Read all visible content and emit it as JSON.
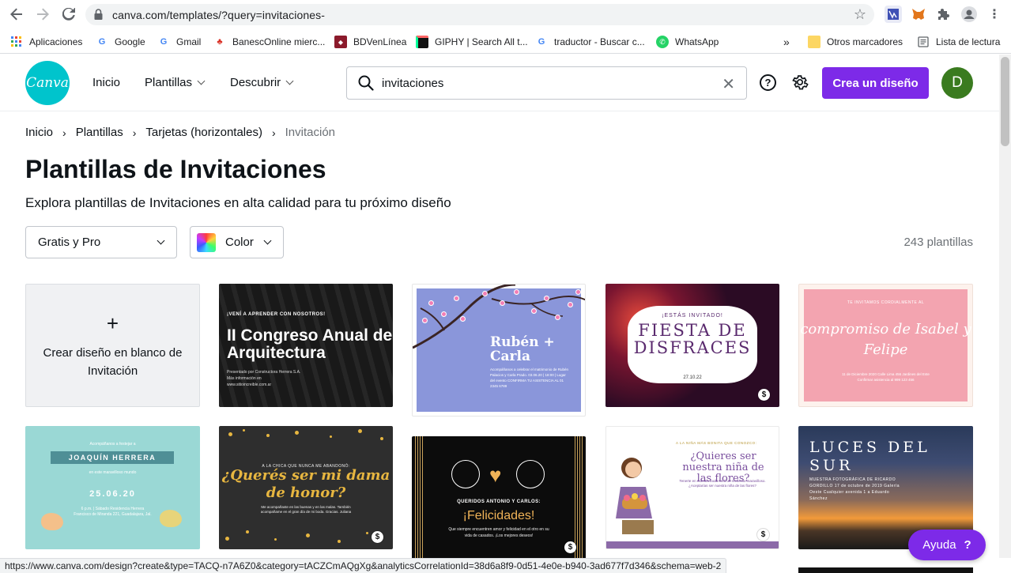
{
  "browser": {
    "url": "canva.com/templates/?query=invitaciones-",
    "status_url": "https://www.canva.com/design?create&type=TACQ-n7A6Z0&category=tACZCmAQgXg&analyticsCorrelationId=38d6a8f9-0d51-4e0e-b940-3ad677f7d346&schema=web-2"
  },
  "bookmarks": {
    "items": [
      {
        "label": "Aplicaciones"
      },
      {
        "label": "Google"
      },
      {
        "label": "Gmail"
      },
      {
        "label": "BanescOnline mierc..."
      },
      {
        "label": "BDVenLínea"
      },
      {
        "label": "GIPHY | Search All t..."
      },
      {
        "label": "traductor - Buscar c..."
      },
      {
        "label": "WhatsApp"
      }
    ],
    "more": "»",
    "other": "Otros marcadores",
    "reading_list": "Lista de lectura"
  },
  "header": {
    "logo": "Canva",
    "nav": {
      "inicio": "Inicio",
      "plantillas": "Plantillas",
      "descubrir": "Descubrir"
    },
    "search": {
      "value": "invitaciones"
    },
    "create_button": "Crea un diseño",
    "avatar_initial": "D"
  },
  "breadcrumb": {
    "items": [
      "Inicio",
      "Plantillas",
      "Tarjetas (horizontales)"
    ],
    "current": "Invitación"
  },
  "page": {
    "title": "Plantillas de Invitaciones",
    "subtitle": "Explora plantillas de Invitaciones en alta calidad para tu próximo diseño"
  },
  "filters": {
    "price": "Gratis y Pro",
    "color": "Color",
    "count": "243 plantillas"
  },
  "grid": {
    "blank_card": {
      "plus": "+",
      "label": "Crear diseño en blanco de Invitación"
    },
    "congreso": {
      "eyebrow": "¡VENÍ A APRENDER CON NOSOTROS!",
      "title": "II Congreso Anual de Arquitectura",
      "small": "Presentado por Constructora Herrera S.A. Más información en www.sitioincreible.com.ar"
    },
    "ruben": {
      "names": "Rubén + Carla",
      "small": "Acompáñanos a celebrar el matrimonio de Rubén Palacios y Carla Prado. 03.06.20 | 18:00 | Lugar del evento CONFIRMA TU ASISTENCIA AL 01 2345 6789"
    },
    "fiesta": {
      "eyebrow": "¡ESTÁS INVITADO!",
      "title": "FIESTA DE DISFRACES",
      "date": "27.10.22"
    },
    "compromiso": {
      "eyebrow": "TE INVITAMOS CORDIALMENTE AL",
      "title": "compromiso de Isabel y Felipe",
      "details": "11 de Diciembre 2020 Calle Lima 456 Jardines del Este Confirmar asistencia al 999 123 456"
    },
    "joaquin": {
      "top": "Acompáñanos a festejar a",
      "name": "JOAQUÍN HERRERA",
      "mid": "en este maravilloso mundo",
      "date": "25.06.20",
      "details": "6 p.m. | Sábado Residencia Herrera Francisco de Miranda 221, Guadalajara, Jal."
    },
    "dama": {
      "eyebrow": "A LA CHICA QUE NUNCA ME ABANDONÓ:",
      "title": "¿Querés ser mi dama de honor?",
      "small": "Me acompañaste en las buenas y en las malas. También acompañame en el gran día de mi boda. Gracias. Juliana"
    },
    "antonio": {
      "eyebrow": "QUERIDOS ANTONIO Y CARLOS:",
      "title": "¡Felicidades!",
      "small": "Que siempre encuentren amor y felicidad en el otro en su vida de casados. ¡Los mejores deseos!"
    },
    "nina": {
      "eyebrow": "A LA NIÑA MÁS BONITA QUE CONOZCO:",
      "title": "¿Quieres ser nuestra niña de las flores?",
      "small": "Tenerte en nuestra boda será un recuerdo maravilloso. ¿Aceptarías ser nuestra niña de las flores?"
    },
    "luces": {
      "title": "LUCES DEL SUR",
      "small": "MUESTRA FOTOGRÁFICA DE RICARDO GORDILLO 17 de octubre de 2019 Galería Oeste Cualquier avenida 1 a Eduardo Sánchez"
    },
    "pro_symbol": "$"
  },
  "help": {
    "label": "Ayuda",
    "symbol": "?"
  }
}
